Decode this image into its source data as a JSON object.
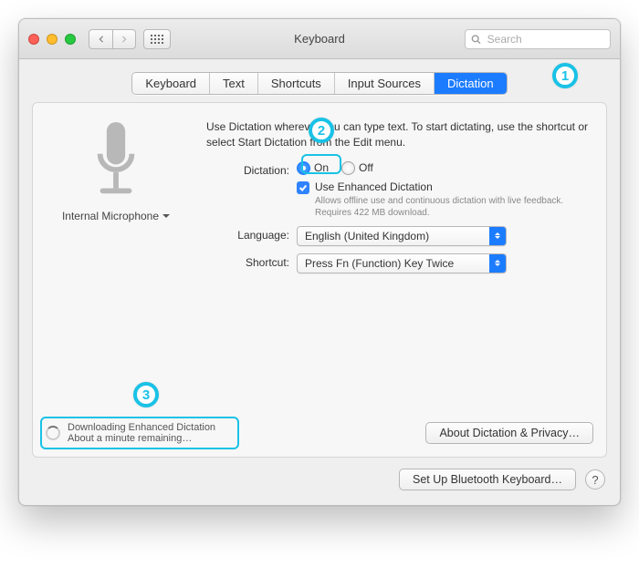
{
  "window": {
    "title": "Keyboard"
  },
  "search": {
    "placeholder": "Search"
  },
  "tabs": [
    {
      "label": "Keyboard"
    },
    {
      "label": "Text"
    },
    {
      "label": "Shortcuts"
    },
    {
      "label": "Input Sources"
    },
    {
      "label": "Dictation"
    }
  ],
  "mic": {
    "label": "Internal Microphone"
  },
  "intro": "Use Dictation wherever you can type text. To start dictating, use the shortcut or select Start Dictation from the Edit menu.",
  "dictation": {
    "label": "Dictation:",
    "on": "On",
    "off": "Off",
    "enhanced_label": "Use Enhanced Dictation",
    "enhanced_note": "Allows offline use and continuous dictation with live feedback. Requires 422 MB download."
  },
  "language": {
    "label": "Language:",
    "value": "English (United Kingdom)"
  },
  "shortcut": {
    "label": "Shortcut:",
    "value": "Press Fn (Function) Key Twice"
  },
  "download": {
    "title": "Downloading Enhanced Dictation",
    "sub": "About a minute remaining…"
  },
  "buttons": {
    "about": "About Dictation & Privacy…",
    "bluetooth": "Set Up Bluetooth Keyboard…"
  },
  "annotations": {
    "a1": "1",
    "a2": "2",
    "a3": "3"
  }
}
